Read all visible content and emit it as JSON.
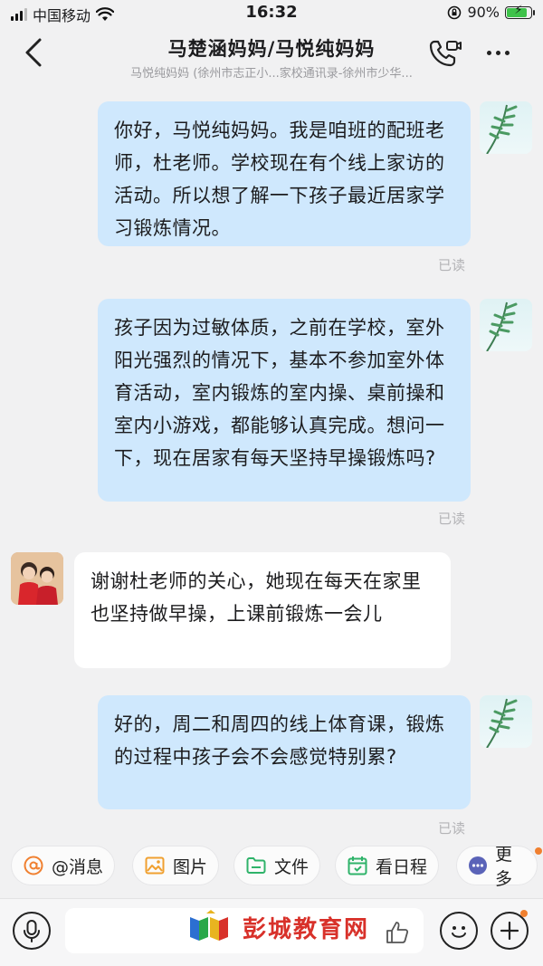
{
  "status_bar": {
    "carrier": "中国移动",
    "time": "16:32",
    "battery_percent": "90%",
    "battery_level": 0.9
  },
  "header": {
    "title": "马楚涵妈妈/马悦纯妈妈",
    "subtitle": "马悦纯妈妈 (徐州市志正小...家校通讯录-徐州市少华..."
  },
  "messages": [
    {
      "direction": "out",
      "text": "你好，马悦纯妈妈。我是咱班的配班老师，杜老师。学校现在有个线上家访的活动。所以想了解一下孩子最近居家学习锻炼情况。",
      "status": "已读"
    },
    {
      "direction": "out",
      "text": "孩子因为过敏体质，之前在学校，室外阳光强烈的情况下，基本不参加室外体育活动，室内锻炼的室内操、桌前操和室内小游戏，都能够认真完成。想问一下，现在居家有每天坚持早操锻炼吗?",
      "status": "已读"
    },
    {
      "direction": "in",
      "text": "谢谢杜老师的关心，她现在每天在家里也坚持做早操，上课前锻炼一会儿"
    },
    {
      "direction": "out",
      "text": "好的，周二和周四的线上体育课，锻炼的过程中孩子会不会感觉特别累?",
      "status": "已读"
    }
  ],
  "quick_actions": [
    {
      "label": "@消息",
      "icon": "at-icon"
    },
    {
      "label": "图片",
      "icon": "image-icon"
    },
    {
      "label": "文件",
      "icon": "folder-icon"
    },
    {
      "label": "看日程",
      "icon": "calendar-icon"
    },
    {
      "label": "更多",
      "icon": "more-icon"
    }
  ],
  "input_bar": {
    "watermark": "彭城教育网"
  },
  "colors": {
    "outgoing_bubble": "#cfe8fd",
    "incoming_bubble": "#ffffff",
    "background": "#f1f1f2",
    "watermark_red": "#d8312a",
    "accent_orange": "#f08030"
  }
}
